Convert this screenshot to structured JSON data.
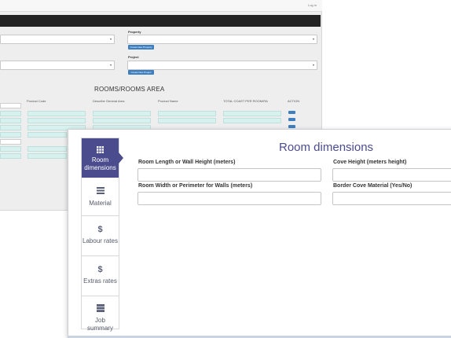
{
  "background_app": {
    "login_text": "Log in",
    "property_label": "Property",
    "create_property_button": "Create New Property",
    "project_label": "Project",
    "create_project_button": "Create New Project",
    "section_title": "ROOMS/ROOMS AREA",
    "columns": [
      "Product Code",
      "Describe General Area",
      "Product Name",
      "TOTAL COAST PER ROOM/RA",
      "ACTION"
    ]
  },
  "tabs": [
    {
      "label": "Room dimensions",
      "icon": "grid-icon",
      "active": true
    },
    {
      "label": "Material",
      "icon": "stack-icon",
      "active": false
    },
    {
      "label": "Labour rates",
      "icon": "dollar-icon",
      "active": false
    },
    {
      "label": "Extras rates",
      "icon": "dollar-icon",
      "active": false
    },
    {
      "label": "Job summary",
      "icon": "server-icon",
      "active": false
    }
  ],
  "form": {
    "title": "Room dimensions",
    "fields": [
      {
        "label": "Room Length or Wall Height (meters)",
        "value": ""
      },
      {
        "label": "Cove Height (meters height)",
        "value": ""
      },
      {
        "label": "Room Width or Perimeter for Walls (meters)",
        "value": ""
      },
      {
        "label": "Border Cove Material (Yes/No)",
        "value": ""
      }
    ]
  },
  "colors": {
    "accent": "#4b4c8d",
    "background_row": "#d7f1ef",
    "background_button": "#3d7fc1"
  }
}
